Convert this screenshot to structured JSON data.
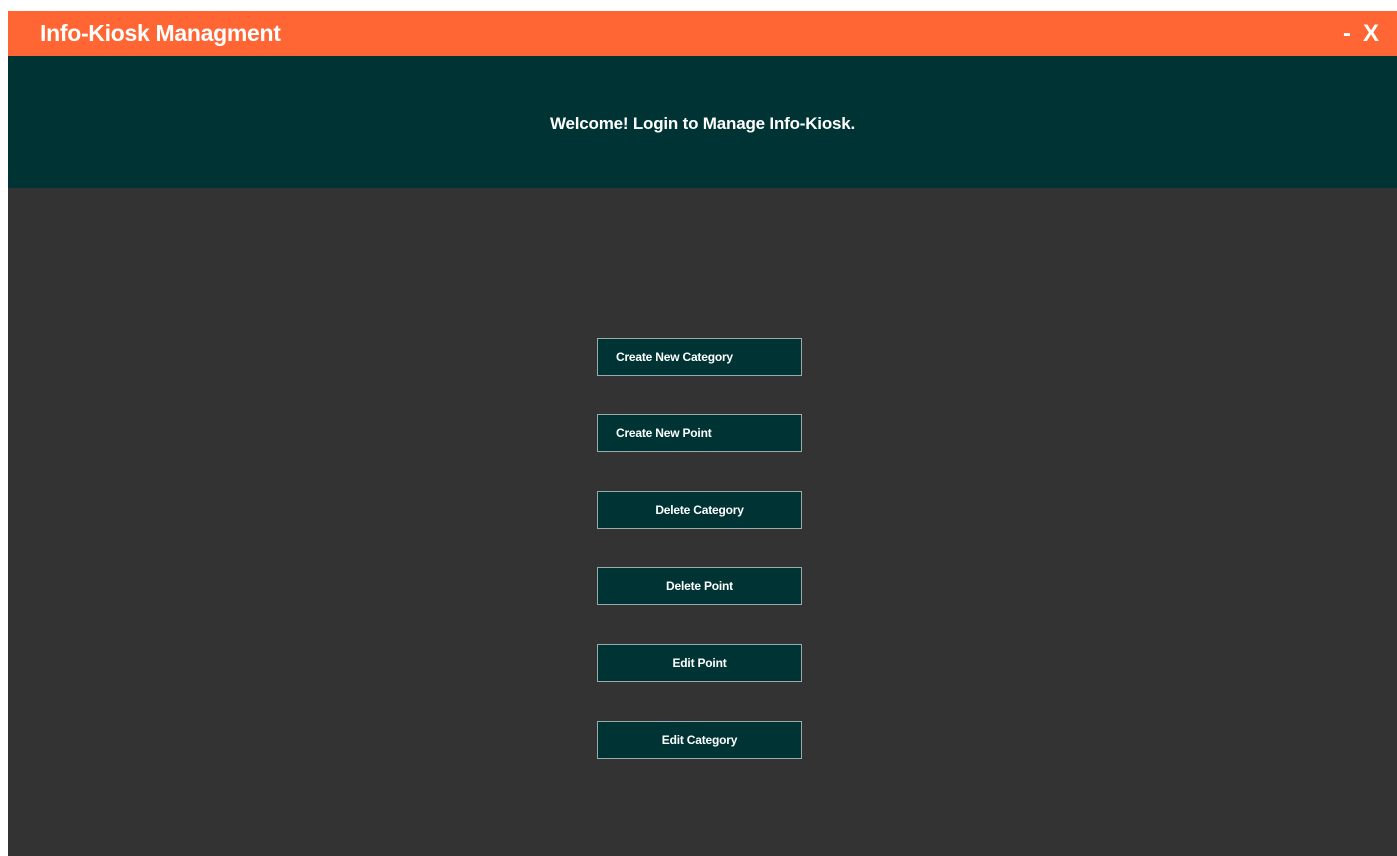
{
  "window": {
    "title": "Info-Kiosk Managment",
    "minimize_label": "-",
    "close_label": "X"
  },
  "header": {
    "welcome_text": "Welcome! Login to Manage Info-Kiosk."
  },
  "actions": [
    {
      "label": "Create New Category"
    },
    {
      "label": "Create New Point"
    },
    {
      "label": "Delete Category"
    },
    {
      "label": "Delete Point"
    },
    {
      "label": "Edit Point"
    },
    {
      "label": "Edit Category"
    }
  ],
  "colors": {
    "titlebar": "#ff6633",
    "header_banner": "#003333",
    "body_background": "#333333",
    "button_background": "#003333",
    "text": "#ffffff"
  }
}
